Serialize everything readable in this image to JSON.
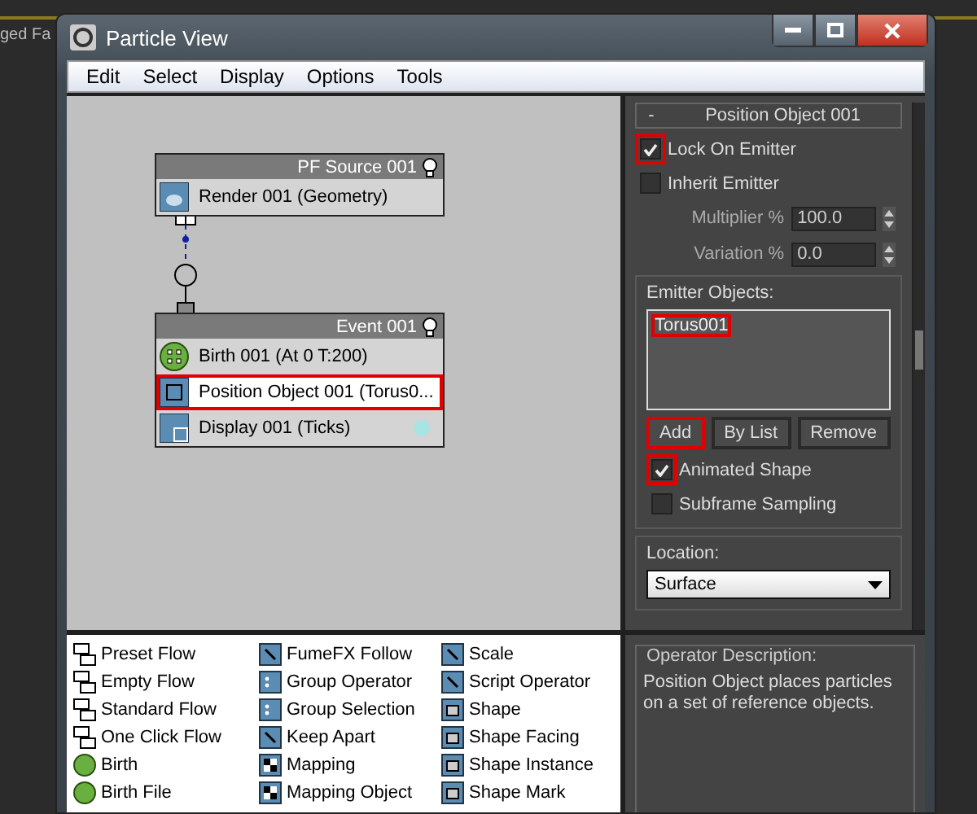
{
  "background_text": "ged Fa",
  "window": {
    "title": "Particle View"
  },
  "menu": [
    "Edit",
    "Select",
    "Display",
    "Options",
    "Tools"
  ],
  "flow": {
    "nodes": [
      {
        "title": "PF Source 001",
        "items": [
          {
            "label": "Render 001 (Geometry)",
            "kind": "render",
            "selected": false,
            "highlighted": false
          }
        ]
      },
      {
        "title": "Event 001",
        "items": [
          {
            "label": "Birth 001 (At 0 T:200)",
            "kind": "birth",
            "selected": false,
            "highlighted": false
          },
          {
            "label": "Position Object 001 (Torus0...",
            "kind": "position",
            "selected": true,
            "highlighted": true
          },
          {
            "label": "Display 001 (Ticks)",
            "kind": "display",
            "selected": false,
            "highlighted": false,
            "color": "#a8e4e4"
          }
        ]
      }
    ]
  },
  "rollout": {
    "toggle": "-",
    "title": "Position Object 001",
    "checkboxes": [
      {
        "label": "Lock On Emitter",
        "checked": true,
        "highlighted": true
      },
      {
        "label": "Inherit Emitter",
        "checked": false,
        "highlighted": false
      }
    ],
    "spinners": [
      {
        "label": "Multiplier %",
        "value": "100.0"
      },
      {
        "label": "Variation %",
        "value": "0.0"
      }
    ],
    "emitter_objects": {
      "label": "Emitter Objects:",
      "items": [
        {
          "name": "Torus001",
          "highlighted": true
        }
      ]
    },
    "buttons": [
      {
        "label": "Add",
        "highlighted": true
      },
      {
        "label": "By List",
        "highlighted": false
      },
      {
        "label": "Remove",
        "highlighted": false
      }
    ],
    "options": [
      {
        "label": "Animated Shape",
        "checked": true,
        "highlighted": true
      },
      {
        "label": "Subframe Sampling",
        "checked": false,
        "highlighted": false
      }
    ],
    "location": {
      "label": "Location:",
      "value": "Surface"
    }
  },
  "depot": {
    "columns": [
      [
        {
          "label": "Preset Flow",
          "kind": "flow"
        },
        {
          "label": "Empty Flow",
          "kind": "flow"
        },
        {
          "label": "Standard Flow",
          "kind": "flow"
        },
        {
          "label": "One Click Flow",
          "kind": "flow"
        },
        {
          "label": "Birth",
          "kind": "birth"
        },
        {
          "label": "Birth File",
          "kind": "birth"
        }
      ],
      [
        {
          "label": "FumeFX Follow",
          "kind": "operator"
        },
        {
          "label": "Group Operator",
          "kind": "group"
        },
        {
          "label": "Group Selection",
          "kind": "group"
        },
        {
          "label": "Keep Apart",
          "kind": "operator"
        },
        {
          "label": "Mapping",
          "kind": "mapping"
        },
        {
          "label": "Mapping Object",
          "kind": "mapping"
        }
      ],
      [
        {
          "label": "Scale",
          "kind": "operator"
        },
        {
          "label": "Script Operator",
          "kind": "operator"
        },
        {
          "label": "Shape",
          "kind": "shape"
        },
        {
          "label": "Shape Facing",
          "kind": "shape"
        },
        {
          "label": "Shape Instance",
          "kind": "shape"
        },
        {
          "label": "Shape Mark",
          "kind": "shape"
        }
      ]
    ]
  },
  "description": {
    "label": "Operator Description:",
    "text": "Position Object places particles on a set of reference objects."
  }
}
